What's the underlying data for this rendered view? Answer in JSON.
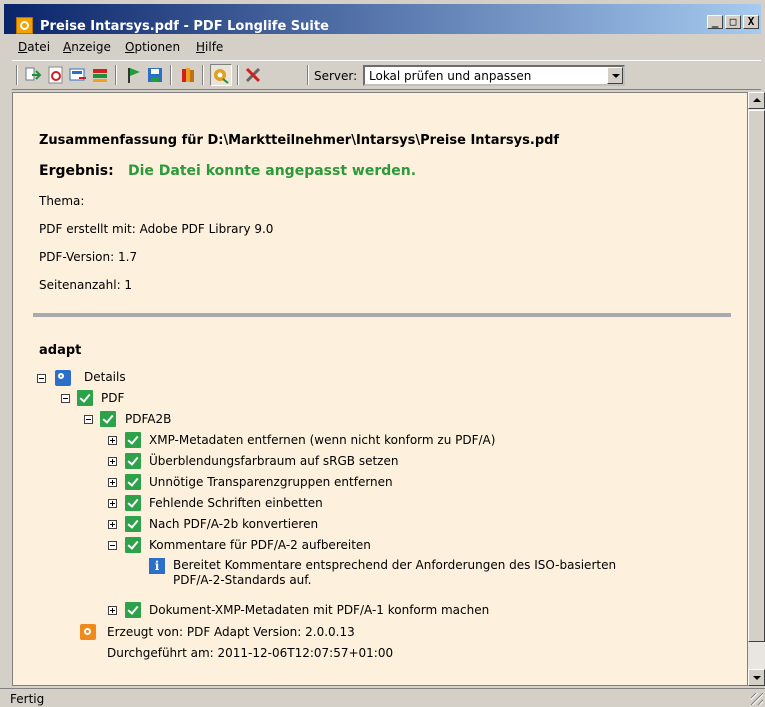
{
  "window": {
    "title": "Preise Intarsys.pdf - PDF Longlife Suite",
    "minimize": "_",
    "maximize": "□",
    "close": "X"
  },
  "menu": [
    "Datei",
    "Anzeige",
    "Optionen",
    "Hilfe"
  ],
  "menu_hotkeys": [
    "D",
    "A",
    "O",
    "H"
  ],
  "toolbar": {
    "server_label": "Server:",
    "server_value": "Lokal prüfen und anpassen",
    "buttons": [
      "import-icon",
      "pdf-open-icon",
      "export-icon",
      "convert-icon",
      "flag-icon",
      "save-icon",
      "books-icon",
      "settings-icon",
      "tools-icon"
    ]
  },
  "summary": {
    "title": "Zusammenfassung für D:\\Marktteilnehmer\\Intarsys\\Preise Intarsys.pdf",
    "result_label": "Ergebnis:",
    "result_value": "Die Datei konnte angepasst werden.",
    "result_color": "#2a9a3a",
    "info": [
      "Thema:",
      "PDF erstellt mit: Adobe PDF Library 9.0",
      "PDF-Version: 1.7",
      "Seitenanzahl: 1"
    ]
  },
  "adapt": {
    "heading": "adapt",
    "details": "Details",
    "pdf": "PDF",
    "profile": "PDFA2B",
    "steps": [
      "XMP-Metadaten entfernen (wenn nicht konform zu PDF/A)",
      "Überblendungsfarbraum auf sRGB setzen",
      "Unnötige Transparenzgruppen entfernen",
      "Fehlende Schriften einbetten",
      "Nach PDF/A-2b konvertieren",
      "Kommentare für PDF/A-2 aufbereiten"
    ],
    "info_text": [
      "Bereitet Kommentare entsprechend der Anforderungen des ISO-basierten",
      "PDF/A-2-Standards auf."
    ],
    "last_step": "Dokument-XMP-Metadaten mit PDF/A-1 konform machen",
    "produced_by": "Erzeugt von: PDF Adapt Version: 2.0.0.13",
    "executed_at": "Durchgeführt am: 2011-12-06T12:07:57+01:00"
  },
  "status": "Fertig"
}
